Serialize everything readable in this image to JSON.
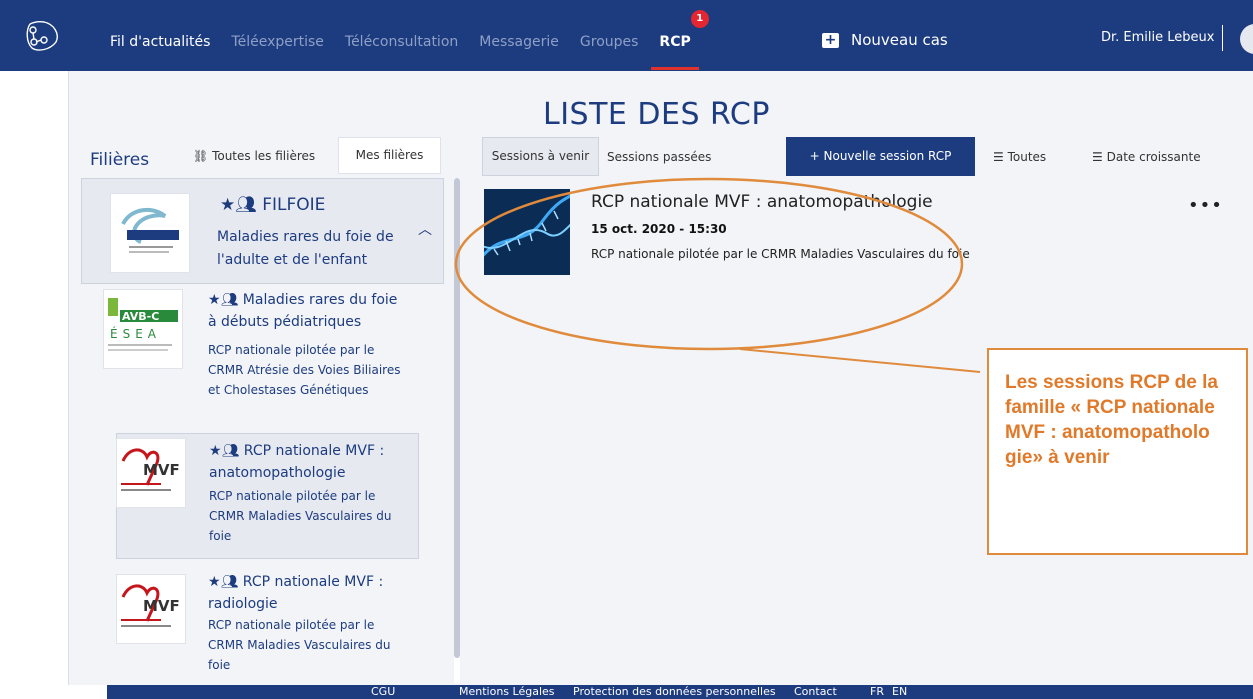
{
  "header": {
    "nav": [
      "Fil d'actualités",
      "Téléexpertise",
      "Téléconsultation",
      "Messagerie",
      "Groupes",
      "RCP"
    ],
    "rcp_badge": "1",
    "new_case": "Nouveau cas",
    "user_name": "Dr. Emilie Lebeux"
  },
  "page_title": "LISTE DES RCP",
  "filieres": {
    "label": "Filières",
    "all": "Toutes les filières",
    "mine": "Mes filières",
    "head": {
      "title": "FILFOIE",
      "desc": "Maladies rares du foie de l'adulte et de l'enfant",
      "logo_text": "FILFOIE"
    },
    "items": [
      {
        "title": "Maladies rares du foie à débuts pédiatriques",
        "desc": "RCP nationale pilotée par le CRMR Atrésie des Voies Biliaires et Cholestases Génétiques",
        "logo_text": "AVB-C"
      },
      {
        "title": "RCP nationale MVF : anatomopathologie",
        "desc": "RCP nationale pilotée par le CRMR Maladies Vasculaires du foie",
        "logo_text": "MVF"
      },
      {
        "title": "RCP nationale MVF : radiologie",
        "desc": "RCP nationale pilotée par le CRMR Maladies Vasculaires du foie",
        "logo_text": "MVF"
      }
    ]
  },
  "sessions": {
    "tab_upcoming": "Sessions à venir",
    "tab_past": "Sessions passées",
    "new_button": "+ Nouvelle session RCP",
    "filter_all": "Toutes",
    "filter_date": "Date croissante",
    "card": {
      "title": "RCP nationale MVF : anatomopathologie",
      "date": "15 oct. 2020 - 15:30",
      "desc": "RCP nationale pilotée par le CRMR Maladies Vasculaires du foie",
      "more": "•••"
    }
  },
  "annotation": "Les sessions RCP de la famille « RCP nationale MVF : anatomopatholo gie» à venir",
  "footer": [
    "CGU",
    "Mentions Légales",
    "Protection des données personnelles",
    "Contact",
    "FR",
    "EN"
  ],
  "colors": {
    "brand": "#1d3c7f",
    "badge": "#e3262f",
    "annotation": "#e07a2a"
  }
}
